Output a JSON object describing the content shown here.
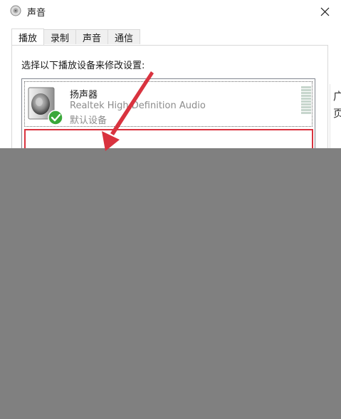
{
  "window": {
    "title": "声音",
    "close_glyph": "✕"
  },
  "tabs": [
    {
      "label": "播放",
      "active": true
    },
    {
      "label": "录制",
      "active": false
    },
    {
      "label": "声音",
      "active": false
    },
    {
      "label": "通信",
      "active": false
    }
  ],
  "playback": {
    "instruction": "选择以下播放设备来修改设置:",
    "device": {
      "name": "扬声器",
      "driver": "Realtek High Definition Audio",
      "status": "默认设备",
      "icon": "speaker-icon",
      "status_icon": "green-check-icon"
    }
  },
  "background_window": {
    "glyphs": [
      "广",
      "页"
    ]
  },
  "colors": {
    "annotation_red": "#d9333f",
    "check_green": "#3aa83a",
    "cover_gray": "#808080",
    "meter_green": "#c7d6cd"
  }
}
